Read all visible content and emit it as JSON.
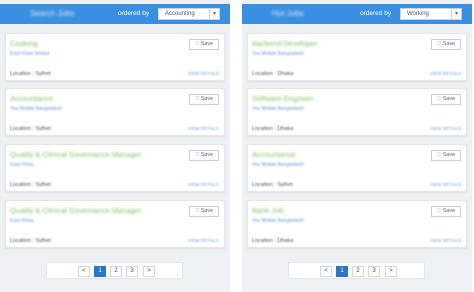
{
  "left": {
    "header": {
      "title": "Search Jobs",
      "order_by_label": "ordered by",
      "select_value": "Accounting",
      "arrow": "▾"
    },
    "jobs": [
      {
        "title": "Cooking",
        "company": "East Fines limited",
        "location": "Location : Sylhet",
        "save_label": "Save",
        "details_label": "VIEW DETAILS"
      },
      {
        "title": "Accountance",
        "company": "Yes Mobile Bangladesh",
        "location": "Location : Sylhet",
        "save_label": "Save",
        "details_label": "VIEW DETAILS"
      },
      {
        "title": "Quality & Clinical Governance Manager",
        "company": "East Fines",
        "location": "Location : Sylhet",
        "save_label": "Save",
        "details_label": "VIEW DETAILS"
      },
      {
        "title": "Quality & Clinical Governance Manager",
        "company": "East Fines",
        "location": "Location : Sylhet",
        "save_label": "Save",
        "details_label": "VIEW DETAILS"
      }
    ],
    "pagination": {
      "prev": "<",
      "pages": [
        "1",
        "2",
        "3"
      ],
      "next": ">",
      "active": "1"
    }
  },
  "right": {
    "header": {
      "title": "Hot Jobs",
      "order_by_label": "ordered by",
      "select_value": "Working",
      "arrow": "▾"
    },
    "jobs": [
      {
        "title": "Backend Developer",
        "company": "Yes Mobile Bangladesh",
        "location": "Location : Dhaka",
        "save_label": "Save",
        "details_label": "VIEW DETAILS"
      },
      {
        "title": "Software Engineer",
        "company": "Yes Mobile Bangladesh",
        "location": "Location : Dhaka",
        "save_label": "Save",
        "details_label": "VIEW DETAILS"
      },
      {
        "title": "Accountance",
        "company": "Yes Mobile Bangladesh",
        "location": "Location : Sylhet",
        "save_label": "Save",
        "details_label": "VIEW DETAILS"
      },
      {
        "title": "Bank Job",
        "company": "Yes Mobile Bangladesh",
        "location": "Location : Dhaka",
        "save_label": "Save",
        "details_label": "VIEW DETAILS"
      }
    ],
    "pagination": {
      "prev": "<",
      "pages": [
        "1",
        "2",
        "3"
      ],
      "next": ">",
      "active": "1"
    }
  },
  "icons": {
    "save": "heart-outline-icon",
    "dropdown": "chevron-down-icon"
  },
  "colors": {
    "header": "#3b8fe0",
    "title_green": "#8cc06a",
    "link_blue": "#6b9fd8",
    "active_page": "#2a77c4"
  }
}
